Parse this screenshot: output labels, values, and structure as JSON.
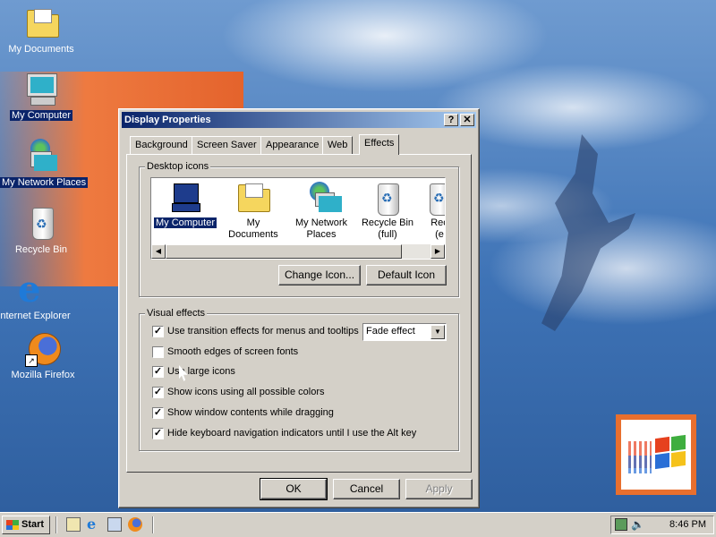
{
  "desktop": {
    "icons": [
      {
        "label": "My Documents"
      },
      {
        "label": "My Computer"
      },
      {
        "label": "My Network Places"
      },
      {
        "label": "Recycle Bin"
      },
      {
        "label": "Internet Explorer"
      },
      {
        "label": "Mozilla Firefox"
      }
    ]
  },
  "dialog": {
    "title": "Display Properties",
    "help_glyph": "?",
    "close_glyph": "✕",
    "tabs": [
      {
        "label": "Background"
      },
      {
        "label": "Screen Saver"
      },
      {
        "label": "Appearance"
      },
      {
        "label": "Web"
      },
      {
        "label": "Effects"
      }
    ],
    "active_tab": "Effects",
    "desktop_icons": {
      "legend": "Desktop icons",
      "items": [
        {
          "line1": "My Computer",
          "line2": ""
        },
        {
          "line1": "My Documents",
          "line2": ""
        },
        {
          "line1": "My Network",
          "line2": "Places"
        },
        {
          "line1": "Recycle Bin",
          "line2": "(full)"
        },
        {
          "line1": "Rec",
          "line2": "(e"
        }
      ],
      "selected": "My Computer",
      "change_icon_label": "Change Icon...",
      "default_icon_label": "Default Icon"
    },
    "visual_effects": {
      "legend": "Visual effects",
      "options": [
        {
          "label": "Use transition effects for menus and tooltips",
          "checked": true,
          "mark": "✓"
        },
        {
          "label": "Smooth edges of screen fonts",
          "checked": false,
          "mark": ""
        },
        {
          "label": "Use large icons",
          "checked": true,
          "mark": "✓"
        },
        {
          "label": "Show icons using all possible colors",
          "checked": true,
          "mark": "✓"
        },
        {
          "label": "Show window contents while dragging",
          "checked": true,
          "mark": "✓"
        },
        {
          "label": "Hide keyboard navigation indicators until I use the Alt key",
          "checked": true,
          "mark": "✓"
        }
      ],
      "transition_effect": "Fade effect"
    },
    "buttons": {
      "ok": "OK",
      "cancel": "Cancel",
      "apply": "Apply"
    }
  },
  "taskbar": {
    "start_label": "Start",
    "clock": "8:46 PM"
  },
  "colors": {
    "selection": "#0a246a",
    "title_gradient_start": "#0a246a",
    "title_gradient_end": "#a6caf0",
    "face": "#d4d0c8"
  }
}
